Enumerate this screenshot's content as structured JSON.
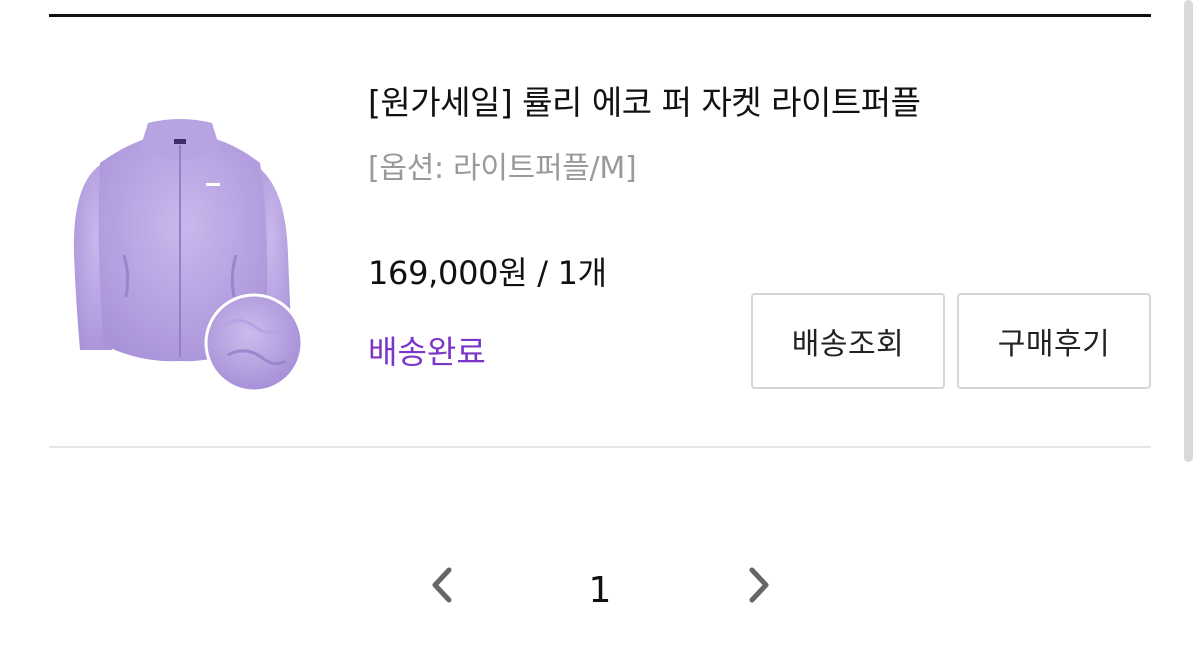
{
  "order_item": {
    "product_name": "[원가세일] 률리 에코 퍼 자켓 라이트퍼플",
    "option": "[옵션: 라이트퍼플/M]",
    "price_quantity": "169,000원 / 1개",
    "status": "배송완료",
    "status_color": "#7b35c8",
    "image_icon": "purple-fleece-jacket"
  },
  "actions": {
    "track_label": "배송조회",
    "review_label": "구매후기"
  },
  "pagination": {
    "current_page": "1",
    "prev_icon": "chevron-left-icon",
    "next_icon": "chevron-right-icon"
  }
}
